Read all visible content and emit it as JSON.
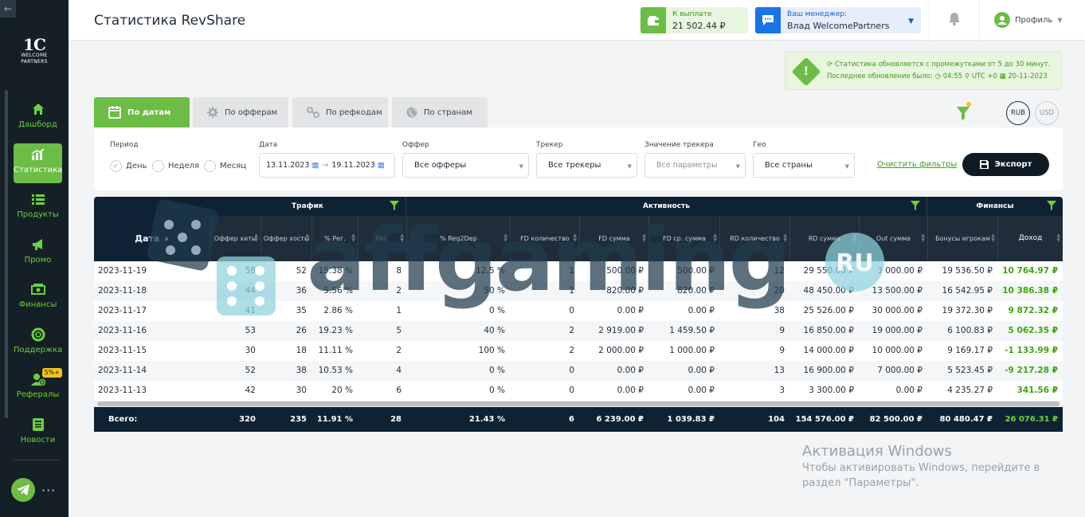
{
  "sidebar": {
    "back_icon": "arrow-left-icon",
    "logo_big": "1C",
    "logo_line1": "WELCOME",
    "logo_line2": "PARTNERS",
    "items": [
      {
        "label": "Дашборд",
        "icon": "home-icon"
      },
      {
        "label": "Статистика",
        "icon": "stats-icon",
        "active": true
      },
      {
        "label": "Продукты",
        "icon": "list-icon"
      },
      {
        "label": "Промо",
        "icon": "megaphone-icon"
      },
      {
        "label": "Финансы",
        "icon": "money-icon"
      },
      {
        "label": "Поддержка",
        "icon": "lifebuoy-icon"
      },
      {
        "label": "Рефералы",
        "icon": "add-user-icon",
        "badge": "5%+"
      },
      {
        "label": "Новости",
        "icon": "news-icon"
      }
    ],
    "more": "···"
  },
  "header": {
    "title": "Статистика RevShare",
    "payout_label": "К выплате",
    "payout_value": "21 502.44 ₽",
    "manager_label": "Ваш менеджер:",
    "manager_name": "Влад WelcomePartners",
    "profile_label": "Профиль"
  },
  "notice": {
    "line1": "Статистика обновляется с промежутками от 5 до 30 минут.",
    "line2_prefix": "Последнее обновление было:",
    "time": "04:55",
    "tz": "UTC +0",
    "date": "20-11-2023"
  },
  "tabs": [
    "По датам",
    "По офферам",
    "По рефкодам",
    "По странам"
  ],
  "currencies": {
    "rub": "RUB",
    "usd": "USD"
  },
  "filters": {
    "period_label": "Период",
    "period_options": [
      "День",
      "Неделя",
      "Месяц"
    ],
    "date_label": "Дата",
    "date_from": "13.11.2023",
    "date_to": "19.11.2023",
    "offer_label": "Оффер",
    "offer_value": "Все офферы",
    "tracker_label": "Трекер",
    "tracker_value": "Все трекеры",
    "tracker_value_label": "Значение трекера",
    "tracker_value_value": "Все параметры",
    "geo_label": "Гео",
    "geo_value": "Все страны",
    "clear": "Очистить фильтры",
    "export": "Экспорт"
  },
  "table": {
    "groups": {
      "traffic": "Трафик",
      "activity": "Активность",
      "finance": "Финансы"
    },
    "date_header": "Дата",
    "columns": [
      "Оффер хиты",
      "Оффер хосты",
      "% Рег.",
      "Рег.",
      "% Reg2Dep",
      "FD количество",
      "FD сумма",
      "FD ср. сумма",
      "RD количество",
      "RD сумма",
      "Out сумма",
      "Бонусы игрокам",
      "Доход"
    ],
    "rows": [
      [
        "2023-11-19",
        "58",
        "52",
        "15.38 %",
        "8",
        "12.5 %",
        "1",
        "500.00 ₽",
        "500.00 ₽",
        "12",
        "29 550.00 ₽",
        "3 000.00 ₽",
        "19 536.50 ₽",
        "10 764.97 ₽"
      ],
      [
        "2023-11-18",
        "44",
        "36",
        "5.56 %",
        "2",
        "50 %",
        "1",
        "820.00 ₽",
        "820.00 ₽",
        "20",
        "48 450.00 ₽",
        "13 500.00 ₽",
        "16 542.95 ₽",
        "10 386.38 ₽"
      ],
      [
        "2023-11-17",
        "41",
        "35",
        "2.86 %",
        "1",
        "0 %",
        "0",
        "0.00 ₽",
        "0.00 ₽",
        "38",
        "25 526.00 ₽",
        "30 000.00 ₽",
        "19 372.30 ₽",
        "9 872.32 ₽"
      ],
      [
        "2023-11-16",
        "53",
        "26",
        "19.23 %",
        "5",
        "40 %",
        "2",
        "2 919.00 ₽",
        "1 459.50 ₽",
        "9",
        "16 850.00 ₽",
        "19 000.00 ₽",
        "6 100.83 ₽",
        "5 062.35 ₽"
      ],
      [
        "2023-11-15",
        "30",
        "18",
        "11.11 %",
        "2",
        "100 %",
        "2",
        "2 000.00 ₽",
        "1 000.00 ₽",
        "9",
        "14 000.00 ₽",
        "10 000.00 ₽",
        "9 169.17 ₽",
        "-1 133.99 ₽"
      ],
      [
        "2023-11-14",
        "52",
        "38",
        "10.53 %",
        "4",
        "0 %",
        "0",
        "0.00 ₽",
        "0.00 ₽",
        "13",
        "16 900.00 ₽",
        "7 000.00 ₽",
        "5 523.45 ₽",
        "-9 217.28 ₽"
      ],
      [
        "2023-11-13",
        "42",
        "30",
        "20 %",
        "6",
        "0 %",
        "0",
        "0.00 ₽",
        "0.00 ₽",
        "3",
        "3 300.00 ₽",
        "0.00 ₽",
        "4 235.27 ₽",
        "341.56 ₽"
      ]
    ],
    "total_label": "Всего:",
    "totals": [
      "320",
      "235",
      "11.91 %",
      "28",
      "21.43 %",
      "6",
      "6 239.00 ₽",
      "1 039.83 ₽",
      "104",
      "154 576.00 ₽",
      "82 500.00 ₽",
      "80 480.47 ₽",
      "26 076.31 ₽"
    ]
  },
  "watermark": {
    "text": "affgaming",
    "suffix": "RU"
  },
  "windows": {
    "title": "Активация Windows",
    "line1": "Чтобы активировать Windows, перейдите в",
    "line2": "раздел \"Параметры\"."
  },
  "colors": {
    "accent": "#6cbd45",
    "dark": "#0f2233",
    "sidebar": "#141f26",
    "positive": "#3aa60f"
  }
}
